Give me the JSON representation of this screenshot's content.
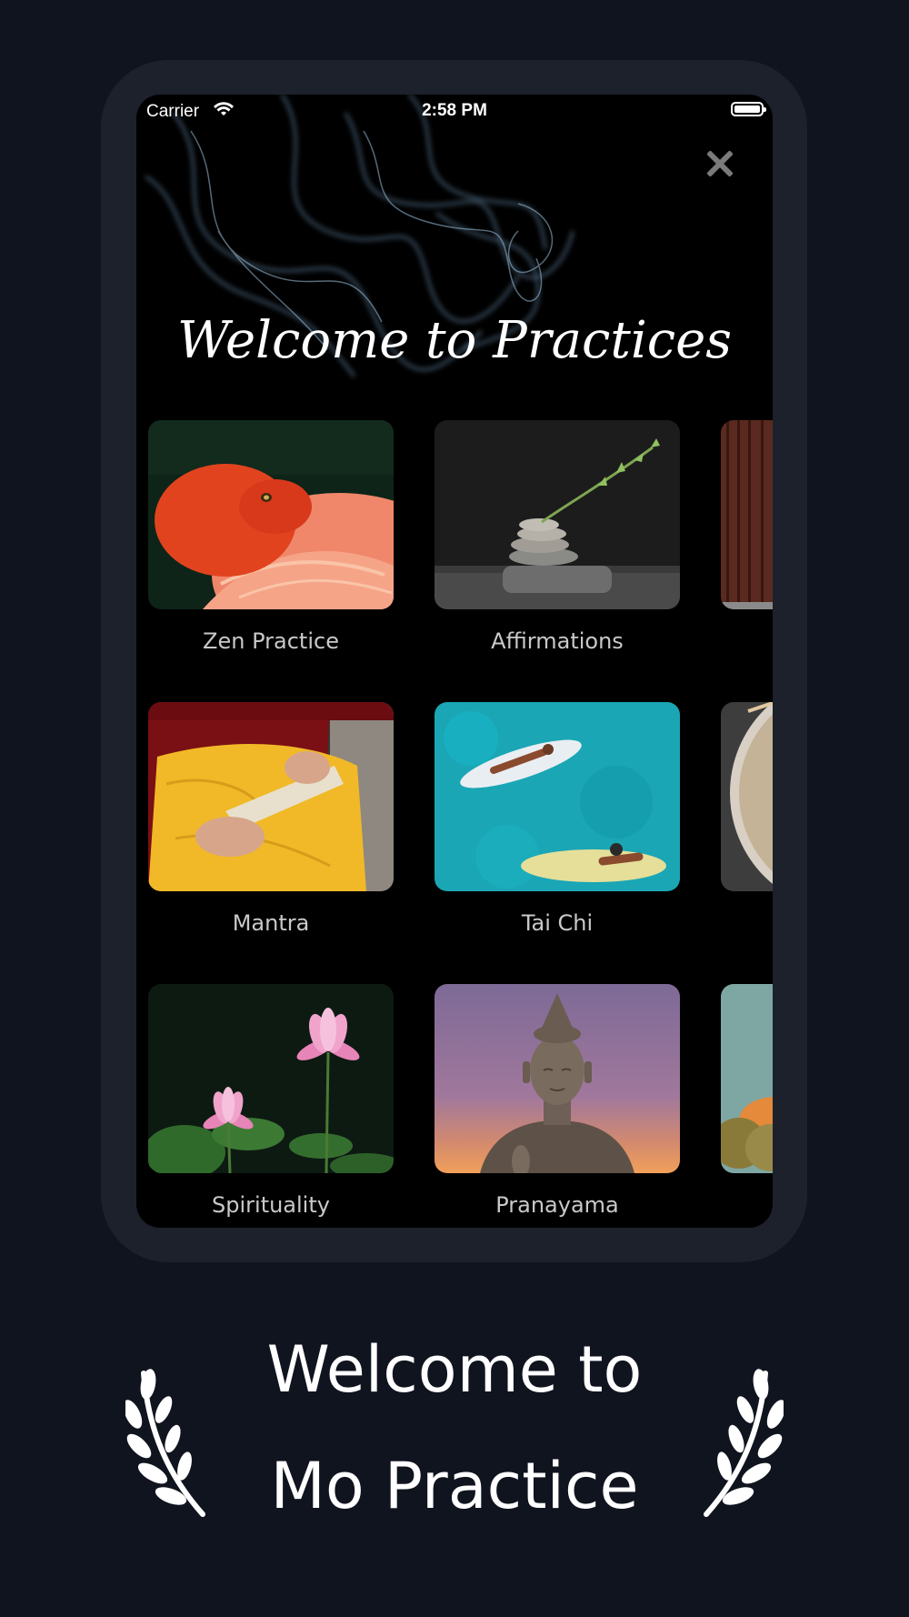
{
  "status_bar": {
    "carrier": "Carrier",
    "time": "2:58 PM"
  },
  "screen": {
    "title": "Welcome to Practices"
  },
  "practices": [
    {
      "label": "Zen Practice"
    },
    {
      "label": "Affirmations"
    },
    {
      "label": "Mantra"
    },
    {
      "label": "Tai Chi"
    },
    {
      "label": "Spirituality"
    },
    {
      "label": "Pranayama"
    }
  ],
  "marketing": {
    "line1": "Welcome to",
    "line2": "Mo Practice"
  },
  "colors": {
    "background": "#10141f",
    "frame": "#1d212c",
    "screen": "#000000",
    "label": "#c9c9c9"
  },
  "icons": [
    "wifi-icon",
    "battery-icon",
    "close-icon",
    "laurel-left-icon",
    "laurel-right-icon"
  ]
}
